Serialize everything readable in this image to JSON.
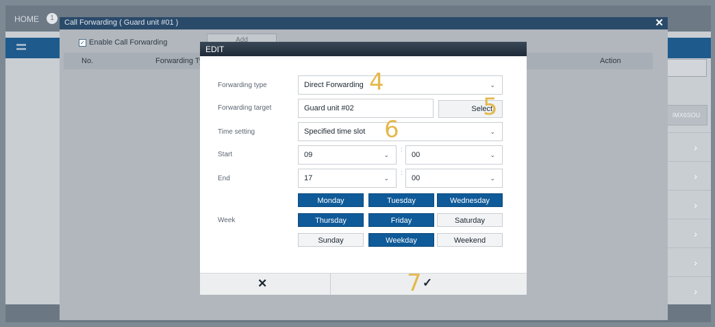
{
  "background": {
    "home_label": "HOME",
    "step_number": "1",
    "id_label": "IMX6SOU"
  },
  "outer_dialog": {
    "title": "Call Forwarding ( Guard unit #01 )",
    "enable_label": "Enable Call Forwarding",
    "enable_checked": true,
    "add_label": "Add",
    "table_headers": [
      "No.",
      "Forwarding Ty",
      "Action"
    ],
    "close_icon": "close-icon"
  },
  "edit": {
    "title": "EDIT",
    "forwarding_type": {
      "label": "Forwarding type",
      "value": "Direct Forwarding"
    },
    "forwarding_target": {
      "label": "Forwarding target",
      "value": "Guard unit #02",
      "select_label": "Select"
    },
    "time_setting": {
      "label": "Time setting",
      "value": "Specified time slot"
    },
    "start": {
      "label": "Start",
      "hour": "09",
      "minute": "00"
    },
    "end": {
      "label": "End",
      "hour": "17",
      "minute": "00"
    },
    "week": {
      "label": "Week",
      "days": [
        {
          "label": "Monday",
          "selected": true
        },
        {
          "label": "Tuesday",
          "selected": true
        },
        {
          "label": "Wednesday",
          "selected": true
        },
        {
          "label": "Thursday",
          "selected": true
        },
        {
          "label": "Friday",
          "selected": true
        },
        {
          "label": "Saturday",
          "selected": false
        },
        {
          "label": "Sunday",
          "selected": false
        },
        {
          "label": "Weekday",
          "selected": true
        },
        {
          "label": "Weekend",
          "selected": false
        }
      ]
    },
    "cancel_glyph": "✕",
    "ok_glyph": "✓"
  },
  "annotations": [
    "4",
    "5",
    "6",
    "7"
  ],
  "colors": {
    "accent": "#0f5a98",
    "annotation": "#e4b84c",
    "header": "#1f2b38"
  }
}
